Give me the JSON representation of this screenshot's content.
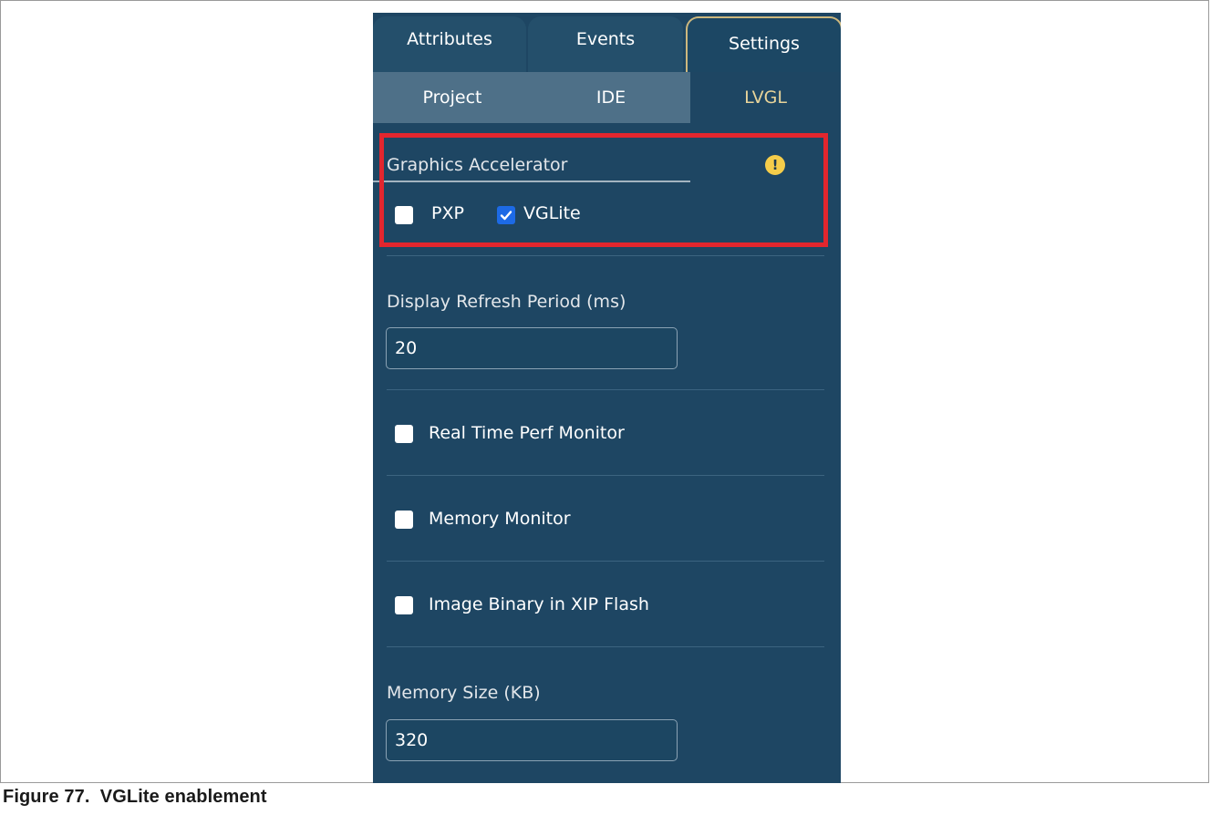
{
  "tabs": [
    {
      "label": "Attributes",
      "active": false
    },
    {
      "label": "Events",
      "active": false
    },
    {
      "label": "Settings",
      "active": true
    }
  ],
  "subtabs": [
    {
      "label": "Project",
      "active": false
    },
    {
      "label": "IDE",
      "active": false
    },
    {
      "label": "LVGL",
      "active": true
    }
  ],
  "graphics_accelerator": {
    "label": "Graphics Accelerator",
    "warning_icon": "exclamation-warning-icon",
    "options": [
      {
        "label": "PXP",
        "checked": false
      },
      {
        "label": "VGLite",
        "checked": true
      }
    ]
  },
  "display_refresh": {
    "label": "Display Refresh Period  (ms)",
    "value": "20"
  },
  "options": [
    {
      "label": "Real Time Perf Monitor",
      "checked": false
    },
    {
      "label": "Memory Monitor",
      "checked": false
    },
    {
      "label": "Image Binary in XIP Flash",
      "checked": false
    }
  ],
  "memory_size": {
    "label": "Memory Size (KB)",
    "value": "320"
  },
  "caption": "Figure 77.  VGLite enablement",
  "colors": {
    "panel_bg": "#1e4663",
    "active_subtab_text": "#e8d49a",
    "highlight_border": "#e3262e",
    "checkbox_checked": "#1d6ae5",
    "warning_icon": "#f5cd4a"
  }
}
